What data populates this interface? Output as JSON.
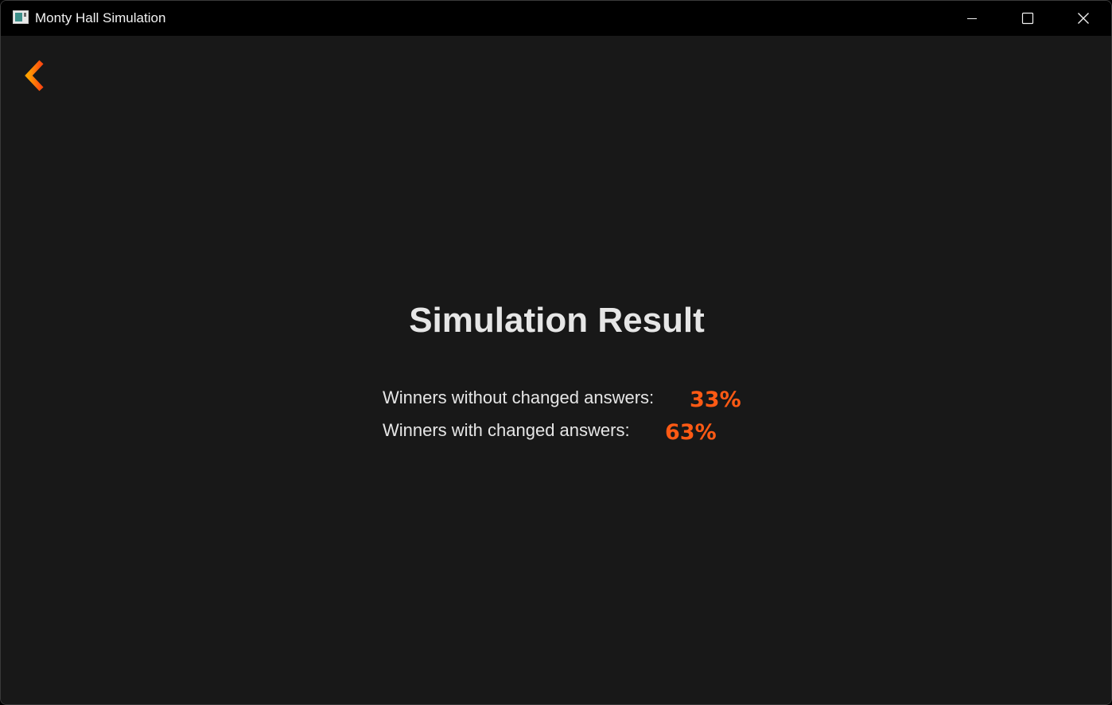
{
  "window": {
    "title": "Monty Hall Simulation",
    "icon": "app-window-icon",
    "controls": {
      "minimize_icon": "minimize-icon",
      "maximize_icon": "maximize-icon",
      "close_icon": "close-icon"
    }
  },
  "back_button": {
    "icon": "arrow-left-icon",
    "color_start": "#ffa000",
    "color_end": "#ff4a10"
  },
  "result": {
    "title": "Simulation Result",
    "rows": [
      {
        "label": "Winners without changed answers:",
        "value": "33%"
      },
      {
        "label": "Winners with changed answers:",
        "value": "63%"
      }
    ]
  },
  "colors": {
    "background": "#181818",
    "titlebar": "#000000",
    "text": "#e6e6e6",
    "accent": "#ff5a14"
  }
}
